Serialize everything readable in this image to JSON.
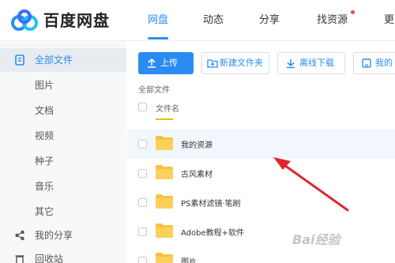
{
  "brand": "百度网盘",
  "nav": [
    {
      "label": "网盘",
      "active": true
    },
    {
      "label": "动态"
    },
    {
      "label": "分享"
    },
    {
      "label": "找资源"
    },
    {
      "label": "更"
    }
  ],
  "sidebar": {
    "items": [
      {
        "label": "全部文件",
        "icon": "folder-list-icon",
        "active": true
      },
      {
        "label": "图片"
      },
      {
        "label": "文档"
      },
      {
        "label": "视频"
      },
      {
        "label": "种子"
      },
      {
        "label": "音乐"
      },
      {
        "label": "其它"
      },
      {
        "label": "我的分享",
        "icon": "share-icon"
      },
      {
        "label": "回收站",
        "icon": "recycle-bin-icon"
      }
    ]
  },
  "toolbar": {
    "upload": "上传",
    "new_folder": "新建文件夹",
    "offline_download": "离线下载",
    "my_devices": "我的"
  },
  "breadcrumb": "全部文件",
  "table": {
    "column_name": "文件名",
    "rows": [
      "我的资源",
      "古风素材",
      "PS素材滤镜·笔刷",
      "Adobe教程+软件",
      "图片"
    ]
  },
  "watermark": "Bai经验",
  "colors": {
    "accent": "#2a8cf0",
    "folder": "#f9c23c",
    "arrow": "#e0262b"
  }
}
